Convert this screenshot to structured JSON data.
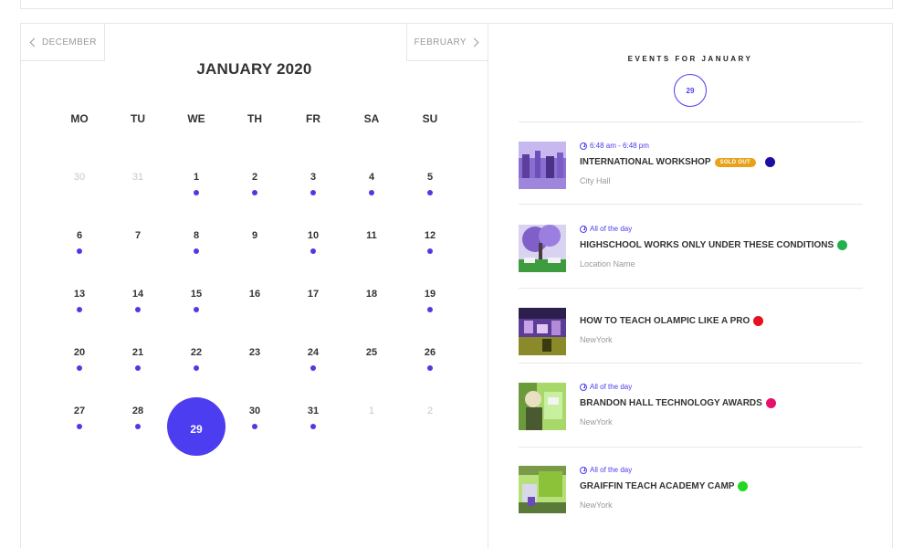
{
  "calendar": {
    "prev_label": "DECEMBER",
    "next_label": "FEBRUARY",
    "month_title": "JANUARY 2020",
    "weekdays": [
      "MO",
      "TU",
      "WE",
      "TH",
      "FR",
      "SA",
      "SU"
    ],
    "selected_day": "29",
    "days": [
      {
        "n": "30",
        "muted": true,
        "dot": false
      },
      {
        "n": "31",
        "muted": true,
        "dot": false
      },
      {
        "n": "1",
        "dot": true
      },
      {
        "n": "2",
        "dot": true
      },
      {
        "n": "3",
        "dot": true
      },
      {
        "n": "4",
        "dot": true
      },
      {
        "n": "5",
        "dot": true
      },
      {
        "n": "6",
        "dot": true
      },
      {
        "n": "7",
        "dot": false
      },
      {
        "n": "8",
        "dot": true
      },
      {
        "n": "9",
        "dot": false
      },
      {
        "n": "10",
        "dot": true
      },
      {
        "n": "11",
        "dot": false
      },
      {
        "n": "12",
        "dot": true
      },
      {
        "n": "13",
        "dot": true
      },
      {
        "n": "14",
        "dot": true
      },
      {
        "n": "15",
        "dot": true
      },
      {
        "n": "16",
        "dot": false
      },
      {
        "n": "17",
        "dot": false
      },
      {
        "n": "18",
        "dot": false
      },
      {
        "n": "19",
        "dot": true
      },
      {
        "n": "20",
        "dot": true
      },
      {
        "n": "21",
        "dot": true
      },
      {
        "n": "22",
        "dot": true
      },
      {
        "n": "23",
        "dot": false
      },
      {
        "n": "24",
        "dot": true
      },
      {
        "n": "25",
        "dot": false
      },
      {
        "n": "26",
        "dot": true
      },
      {
        "n": "27",
        "dot": true
      },
      {
        "n": "28",
        "dot": true
      },
      {
        "n": "29",
        "selected": true,
        "dot": false
      },
      {
        "n": "30",
        "dot": true
      },
      {
        "n": "31",
        "dot": true
      },
      {
        "n": "1",
        "muted": true,
        "dot": false
      },
      {
        "n": "2",
        "muted": true,
        "dot": false
      }
    ]
  },
  "events_panel": {
    "title": "EVENTS FOR JANUARY",
    "day_badge": "29",
    "events": [
      {
        "time": "6:48 am - 6:48 pm",
        "title": "INTERNATIONAL WORKSHOP",
        "badge": "SOLD OUT",
        "color": "#1a0fa0",
        "location": "City Hall",
        "thumb": "purple-crowd"
      },
      {
        "time": "All of the day",
        "title": "HIGHSCHOOL WORKS ONLY UNDER THESE CONDITIONS",
        "badge": "",
        "color": "#22b14c",
        "location": "Location Name",
        "thumb": "tree-park"
      },
      {
        "time": "",
        "title": "HOW TO TEACH OLAMPIC LIKE A PRO",
        "badge": "",
        "color": "#e8101e",
        "location": "NewYork",
        "thumb": "purple-stage"
      },
      {
        "time": "All of the day",
        "title": "BRANDON HALL TECHNOLOGY AWARDS",
        "badge": "",
        "color": "#e8106e",
        "location": "NewYork",
        "thumb": "green-person"
      },
      {
        "time": "All of the day",
        "title": "GRAIFFIN TEACH ACADEMY CAMP",
        "badge": "",
        "color": "#22d822",
        "location": "NewYork",
        "thumb": "green-building"
      }
    ]
  },
  "colors": {
    "accent": "#4c3df0",
    "dot": "#5238e5"
  }
}
